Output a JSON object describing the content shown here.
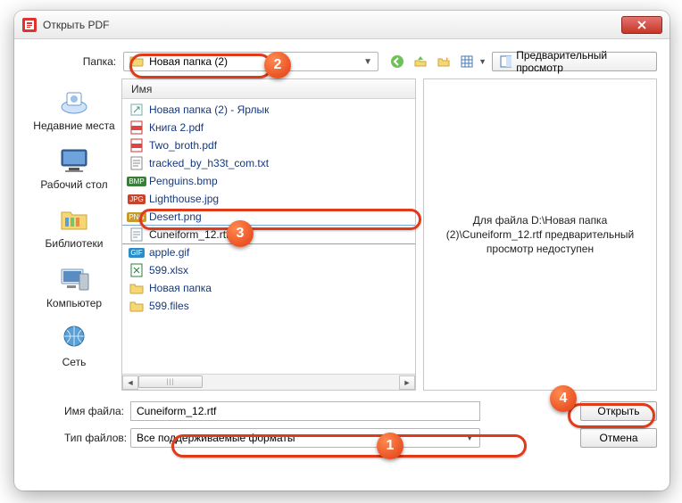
{
  "window": {
    "title": "Открыть PDF"
  },
  "folder_label": "Папка:",
  "folder_value": "Новая папка (2)",
  "preview_button": "Предварительный просмотр",
  "list_header": "Имя",
  "sidebar": {
    "items": [
      {
        "label": "Недавние места"
      },
      {
        "label": "Рабочий стол"
      },
      {
        "label": "Библиотеки"
      },
      {
        "label": "Компьютер"
      },
      {
        "label": "Сеть"
      }
    ]
  },
  "files": [
    {
      "name": "Новая папка (2) - Ярлык",
      "icon": "shortcut"
    },
    {
      "name": "Книга 2.pdf",
      "icon": "pdf"
    },
    {
      "name": "Two_broth.pdf",
      "icon": "pdf"
    },
    {
      "name": "tracked_by_h33t_com.txt",
      "icon": "txt"
    },
    {
      "name": "Penguins.bmp",
      "icon": "bmp"
    },
    {
      "name": "Lighthouse.jpg",
      "icon": "jpg"
    },
    {
      "name": "Desert.png",
      "icon": "png"
    },
    {
      "name": "Cuneiform_12.rtf",
      "icon": "rtf",
      "selected": true
    },
    {
      "name": "apple.gif",
      "icon": "gif"
    },
    {
      "name": "599.xlsx",
      "icon": "xlsx"
    },
    {
      "name": "Новая папка",
      "icon": "folder"
    },
    {
      "name": "599.files",
      "icon": "folder"
    }
  ],
  "preview_msg": "Для файла D:\\Новая папка (2)\\Cuneiform_12.rtf предварительный просмотр недоступен",
  "filename_label": "Имя файла:",
  "filename_value": "Cuneiform_12.rtf",
  "filetype_label": "Тип файлов:",
  "filetype_value": "Все поддерживаемые форматы",
  "open_button": "Открыть",
  "cancel_button": "Отмена",
  "callouts": {
    "1": "1",
    "2": "2",
    "3": "3",
    "4": "4"
  }
}
